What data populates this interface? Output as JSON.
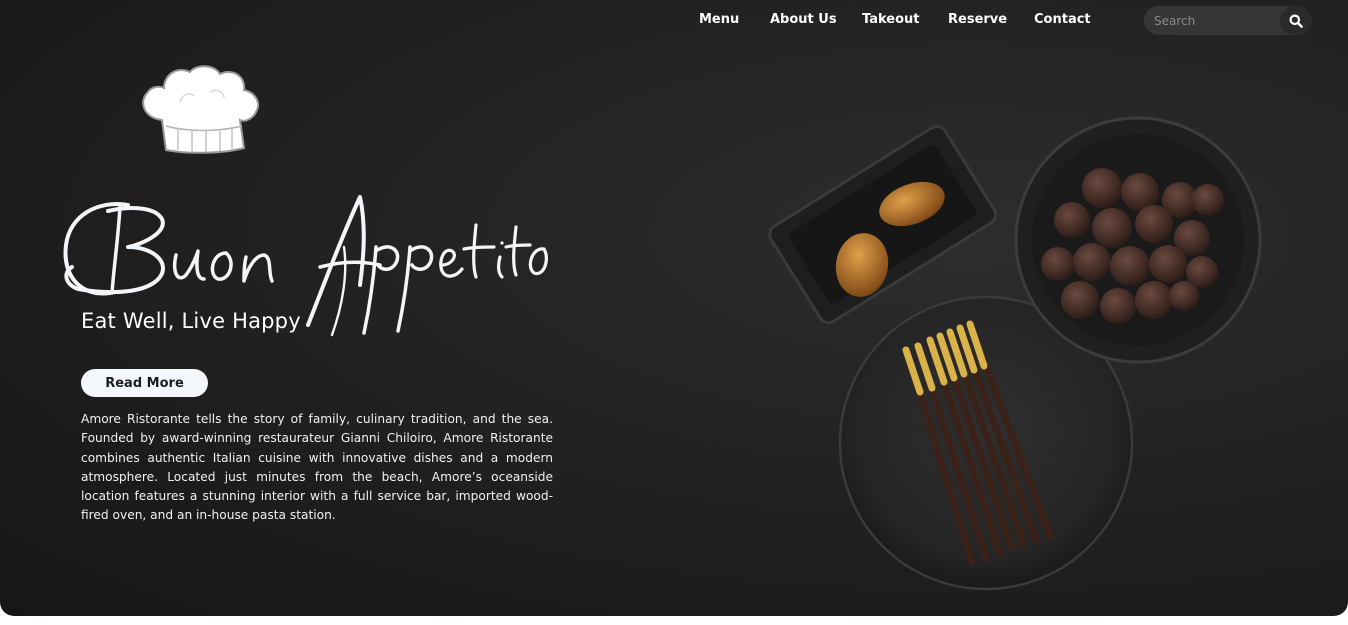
{
  "nav": {
    "items": [
      {
        "label": "Menu"
      },
      {
        "label": "About Us"
      },
      {
        "label": "Takeout"
      },
      {
        "label": "Reserve"
      },
      {
        "label": "Contact"
      }
    ],
    "search": {
      "placeholder": "Search"
    }
  },
  "icons": {
    "logo": "chef-hat-icon",
    "search": "magnifier-icon"
  },
  "hero": {
    "title": "Buon Appetito",
    "tagline": "Eat Well, Live Happy",
    "cta_label": "Read More",
    "description": "Amore Ristorante tells the story of family, culinary tradition, and the sea. Founded by award-winning restaurateur Gianni Chiloiro, Amore Ristorante combines authentic Italian cuisine with innovative dishes and a modern atmosphere. Located just minutes from the beach, Amore’s oceanside location features a stunning interior with a full service bar, imported wood-fired oven, and an in-house pasta station."
  },
  "colors": {
    "background": "#232222",
    "text": "#ffffff",
    "button_bg": "#f4f7fb",
    "search_bg": "#363636"
  }
}
